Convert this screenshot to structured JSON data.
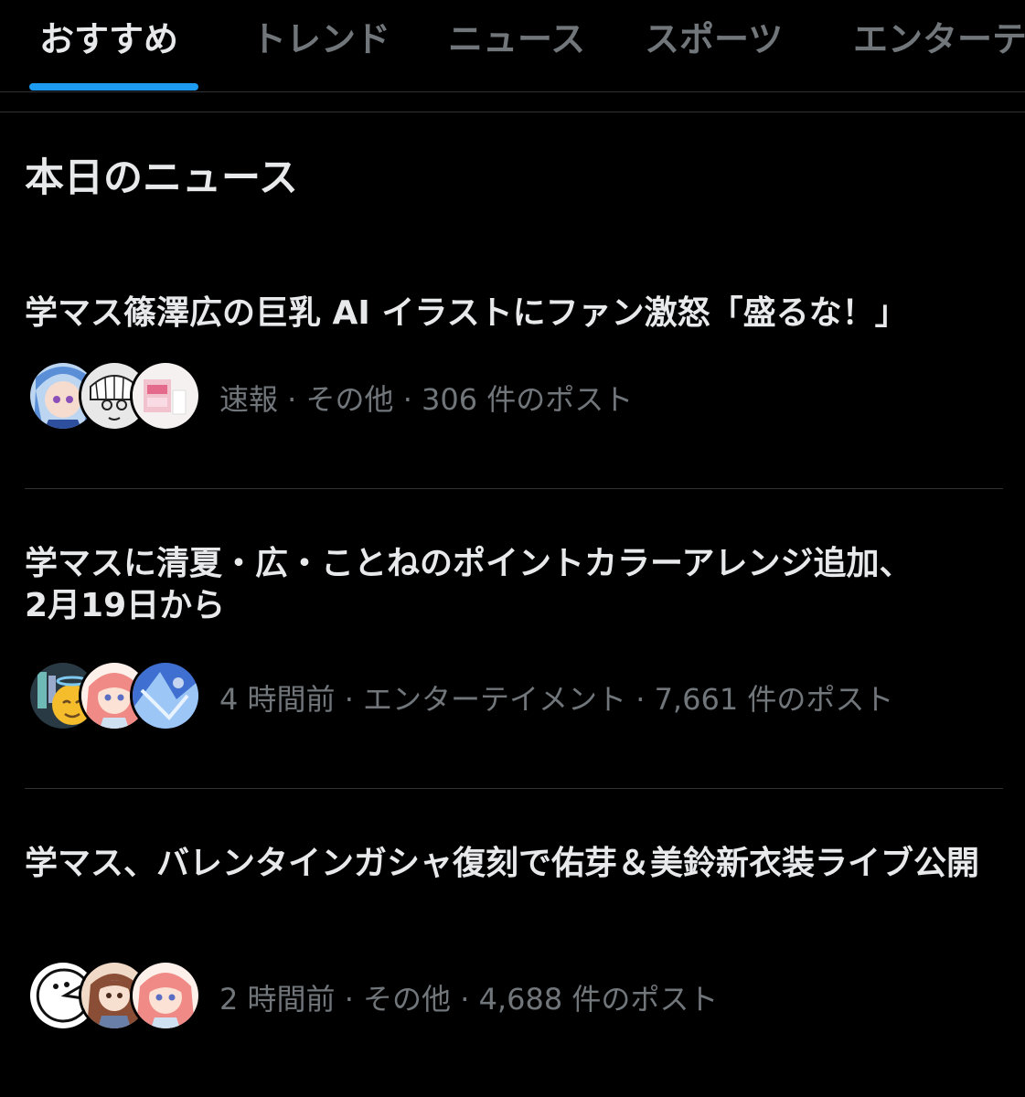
{
  "tabs": [
    {
      "label": "おすすめ",
      "active": true
    },
    {
      "label": "トレンド",
      "active": false
    },
    {
      "label": "ニュース",
      "active": false
    },
    {
      "label": "スポーツ",
      "active": false
    },
    {
      "label": "エンターテ",
      "active": false
    }
  ],
  "accent_color": "#1d9bf0",
  "section": {
    "title": "本日のニュース"
  },
  "news": [
    {
      "headline": "学マス篠澤広の巨乳 AI イラストにファン激怒「盛るな！」",
      "meta": "速報 · その他 · 306 件のポスト",
      "avatars": [
        "anime-girl-blue-hair-avatar",
        "manga-character-avatar",
        "pink-room-avatar"
      ]
    },
    {
      "headline": "学マスに清夏・広・ことねのポイントカラーアレンジ追加、2月19日から",
      "meta": "4 時間前 · エンターテイメント · 7,661 件のポスト",
      "avatars": [
        "halo-emoji-avatar",
        "pink-hair-girl-avatar",
        "blue-crystal-avatar"
      ]
    },
    {
      "headline": "学マス、バレンタインガシャ復刻で佑芽＆美鈴新衣装ライブ公開",
      "meta": "2 時間前 · その他 · 4,688 件のポスト",
      "avatars": [
        "pacman-face-avatar",
        "brown-hair-girl-avatar",
        "pink-hair-girl-avatar"
      ]
    }
  ]
}
